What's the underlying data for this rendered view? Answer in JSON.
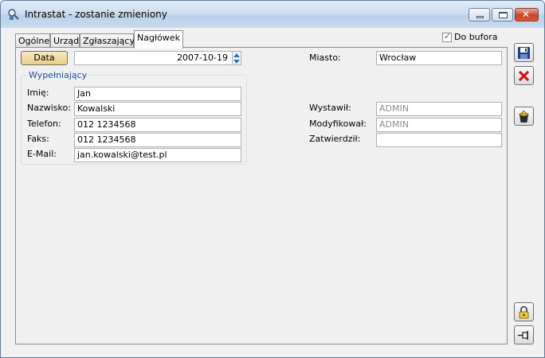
{
  "window": {
    "title": "Intrastat - zostanie zmieniony"
  },
  "tabs": [
    {
      "label": "Ogólne"
    },
    {
      "label": "Urząd"
    },
    {
      "label": "Zgłaszający"
    },
    {
      "label": "Nagłówek"
    }
  ],
  "checkbox": {
    "label": "Do bufora",
    "checked": true
  },
  "header": {
    "data_button": "Data",
    "date_value": "2007-10-19",
    "miasto_label": "Miasto:",
    "miasto_value": "Wrocław"
  },
  "filler": {
    "group_title": "Wypełniający",
    "imie_label": "Imię:",
    "imie_value": "Jan",
    "nazwisko_label": "Nazwisko:",
    "nazwisko_value": "Kowalski",
    "telefon_label": "Telefon:",
    "telefon_value": "012 1234568",
    "faks_label": "Faks:",
    "faks_value": "012 1234568",
    "email_label": "E-Mail:",
    "email_value": "jan.kowalski@test.pl"
  },
  "audit": {
    "wystawil_label": "Wystawił:",
    "wystawil_value": "ADMIN",
    "modyfikowal_label": "Modyfikował:",
    "modyfikowal_value": "ADMIN",
    "zatwierdzil_label": "Zatwierdził:",
    "zatwierdzil_value": ""
  },
  "side_buttons": [
    "save-icon",
    "cancel-icon",
    "bucket-icon",
    "lock-icon",
    "pin-icon"
  ],
  "colors": {
    "accent": "#1e4fa5",
    "button_face": "#e9cf87",
    "cancel_red": "#d01414"
  }
}
